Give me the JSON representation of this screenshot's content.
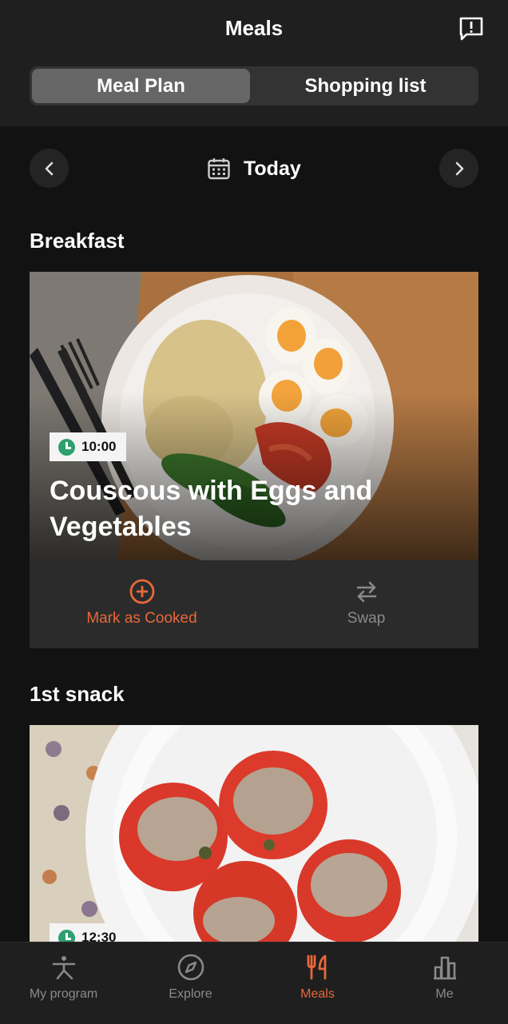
{
  "header": {
    "title": "Meals",
    "feedback_icon": "message-alert-icon"
  },
  "segments": [
    {
      "label": "Meal Plan",
      "active": true
    },
    {
      "label": "Shopping list",
      "active": false
    }
  ],
  "date_nav": {
    "label": "Today",
    "prev_icon": "chevron-left-icon",
    "next_icon": "chevron-right-icon",
    "calendar_icon": "calendar-icon"
  },
  "meals": [
    {
      "section": "Breakfast",
      "time": "10:00",
      "name": "Couscous with Eggs and Vegetables",
      "actions": {
        "cook": "Mark as Cooked",
        "swap": "Swap"
      }
    },
    {
      "section": "1st snack",
      "time": "12:30"
    }
  ],
  "tabs": [
    {
      "label": "My program",
      "icon": "stretch-icon",
      "active": false
    },
    {
      "label": "Explore",
      "icon": "compass-icon",
      "active": false
    },
    {
      "label": "Meals",
      "icon": "fork-knife-icon",
      "active": true
    },
    {
      "label": "Me",
      "icon": "bar-chart-icon",
      "active": false
    }
  ],
  "colors": {
    "accent": "#e8683a",
    "badge_clock": "#2e9f6f",
    "background": "#121212"
  }
}
